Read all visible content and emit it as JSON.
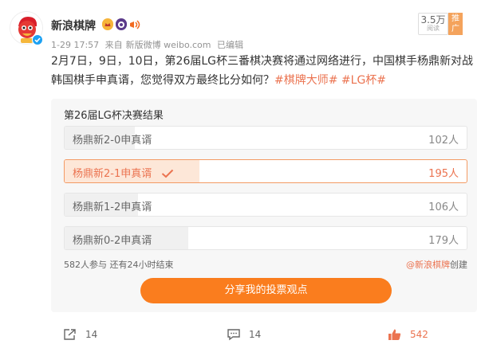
{
  "post": {
    "author": "新浪棋牌",
    "time": "1-29 17:57",
    "source_prefix": "来自",
    "source": "新版微博 weibo.com",
    "edited": "已编辑",
    "views": "3.5万",
    "views_label": "阅读",
    "promote": "推广",
    "text": "2月7日，9日，10日，第26届LG杯三番棋决赛将通过网络进行，中国棋手杨鼎新对战韩国棋手申真谞，您觉得双方最终比分如何？",
    "hashtags": [
      "#棋牌大师#",
      "#LG杯#"
    ]
  },
  "poll": {
    "title": "第26届LG杯决赛结果",
    "options": [
      {
        "label": "杨鼎新2-0申真谞",
        "count": "102人",
        "share": 0.175,
        "selected": false
      },
      {
        "label": "杨鼎新2-1申真谞",
        "count": "195人",
        "share": 0.335,
        "selected": true
      },
      {
        "label": "杨鼎新1-2申真谞",
        "count": "106人",
        "share": 0.182,
        "selected": false
      },
      {
        "label": "杨鼎新0-2申真谞",
        "count": "179人",
        "share": 0.308,
        "selected": false
      }
    ],
    "footer": "582人参与 还有24小时结束",
    "creator": "@新浪棋牌",
    "creator_suffix": "创建",
    "share_button": "分享我的投票观点"
  },
  "actions": {
    "forward": "14",
    "comment": "14",
    "like": "542"
  },
  "colors": {
    "accent": "#eb7350",
    "button": "#fa7d1e",
    "selected_fill": "#fde7d8",
    "fill": "#f0f0f0"
  }
}
